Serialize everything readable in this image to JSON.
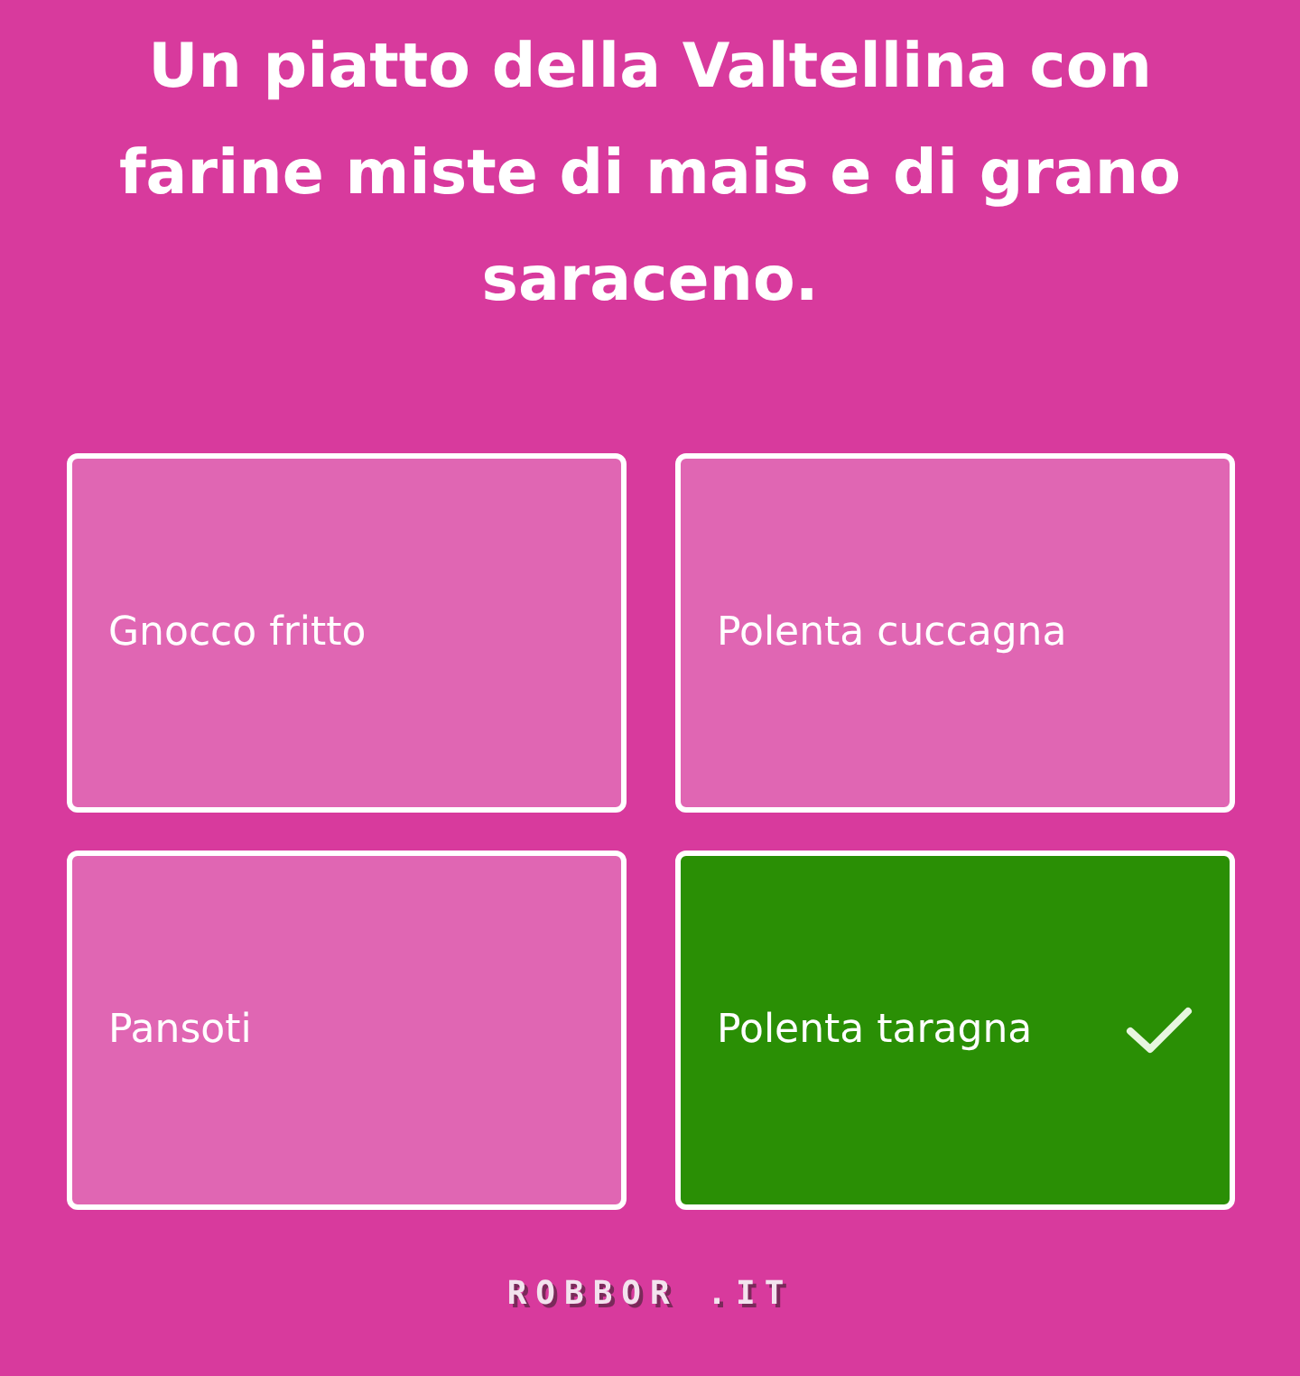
{
  "question": "Un piatto della Valtellina con farine miste di mais e di grano saraceno.",
  "answers": [
    {
      "label": "Gnocco fritto",
      "correct": false
    },
    {
      "label": "Polenta cuccagna",
      "correct": false
    },
    {
      "label": "Pansoti",
      "correct": false
    },
    {
      "label": "Polenta taragna",
      "correct": true
    }
  ],
  "footer": {
    "logo": "ROBBOR .IT"
  }
}
